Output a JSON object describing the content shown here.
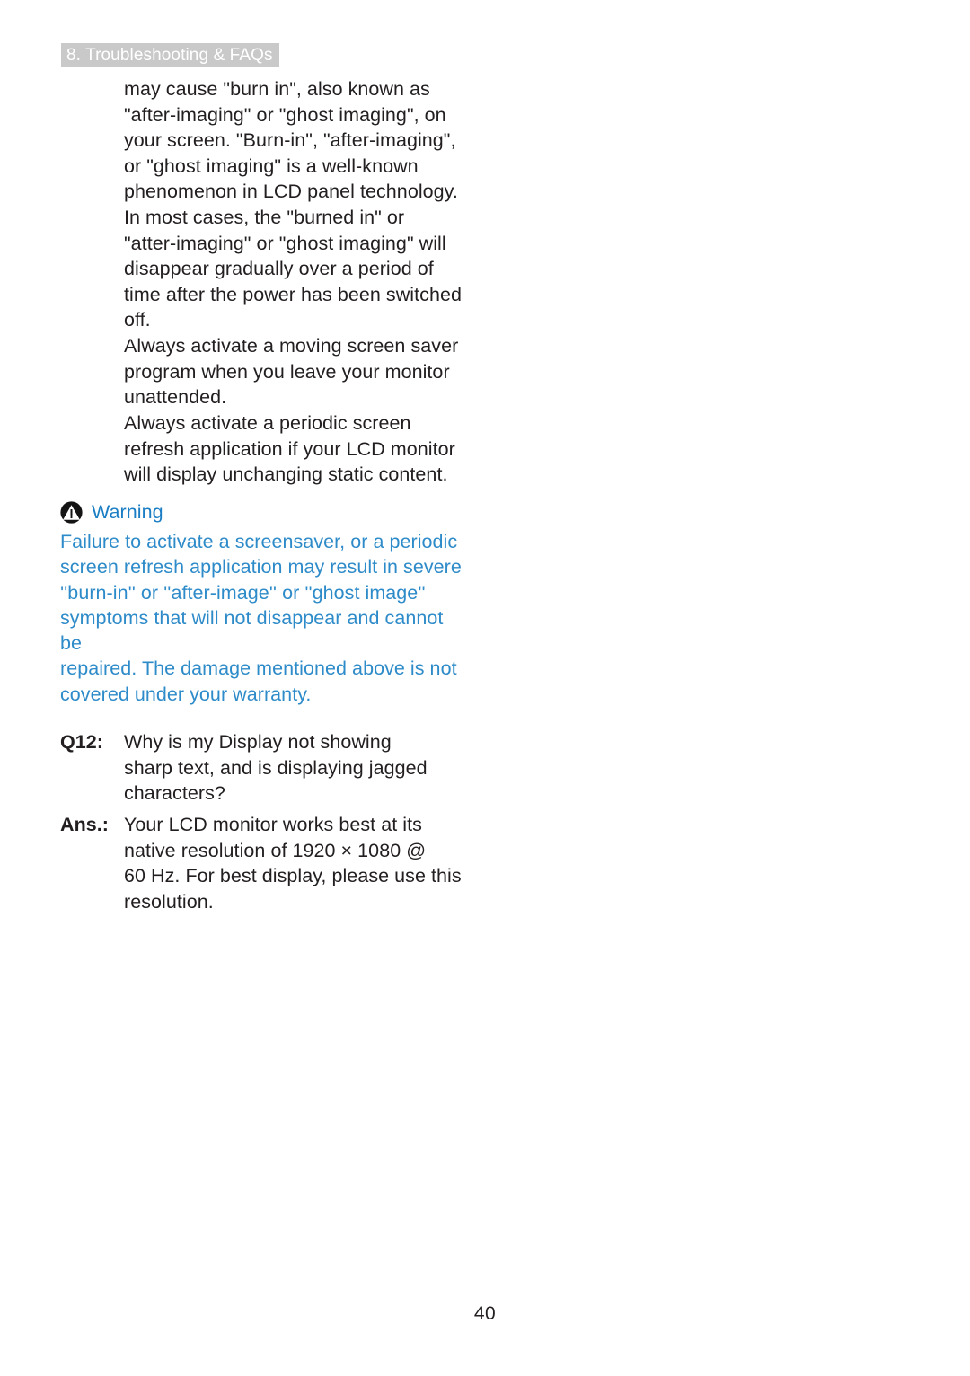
{
  "header": {
    "chapter_label": "8. Troubleshooting & FAQs",
    "background_color": "#c9c9c9",
    "text_color": "#ffffff"
  },
  "body": {
    "paragraph_1": "may cause \"burn in\", also known as\n\"after-imaging\" or \"ghost imaging\", on\nyour screen. \"Burn-in\", \"after-imaging\",\nor \"ghost imaging\" is a well-known\nphenomenon in LCD panel technology.\nIn most cases, the \"burned in\" or\n\"atter-imaging\" or \"ghost imaging\" will\ndisappear gradually over a period of\ntime after the power has been switched\noff.",
    "paragraph_2": "Always activate a moving screen saver\nprogram when you leave your monitor\nunattended.",
    "paragraph_3": "Always activate a periodic screen\nrefresh application if your LCD monitor\nwill display unchanging static content."
  },
  "warning": {
    "icon": "warning-triangle-icon",
    "title": "Warning",
    "title_color": "#1b7ec4",
    "body_color": "#2e8bc9",
    "text": "Failure to activate a screensaver, or a periodic\nscreen refresh application may result in severe\n''burn-in'' or ''after-image'' or ''ghost image''\nsymptoms that will not disappear and cannot be\nrepaired. The damage mentioned above is not\ncovered under your warranty."
  },
  "faq": [
    {
      "label": "Q12:",
      "text": "Why is my Display not showing\nsharp text, and is displaying jagged\ncharacters?"
    },
    {
      "label": "Ans.:",
      "text": "Your LCD monitor works best at its\nnative resolution of 1920 × 1080 @\n60 Hz. For best display, please use this\nresolution."
    }
  ],
  "footer": {
    "page_number": "40"
  }
}
